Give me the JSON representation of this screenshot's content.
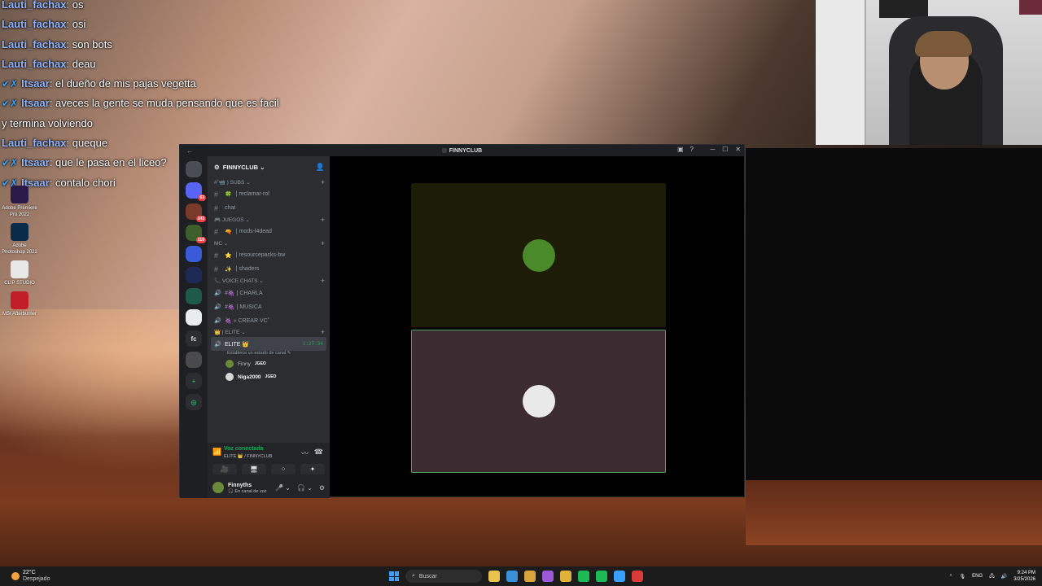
{
  "chat": [
    {
      "user": "Lauti_fachax",
      "text": ": os",
      "badges": false
    },
    {
      "user": "Lauti_fachax",
      "text": ": osi",
      "badges": false
    },
    {
      "user": "Lauti_fachax",
      "text": ": son bots",
      "badges": false
    },
    {
      "user": "Lauti_fachax",
      "text": ": deau",
      "badges": false
    },
    {
      "user": "Itsaar",
      "text": ": el dueño de mis pajas vegetta",
      "badges": true
    },
    {
      "user": "Itsaar",
      "text": ": aveces la gente se muda pensando que es facil",
      "badges": true
    },
    {
      "user": "",
      "text": "y termina volviendo",
      "badges": false
    },
    {
      "user": "Lauti_fachax",
      "text": ": queque",
      "badges": false
    },
    {
      "user": "Itsaar",
      "text": ": que le pasa en el liceo?",
      "badges": true
    },
    {
      "user": "Itsaar",
      "text": ": contalo chori",
      "badges": true
    }
  ],
  "desktop_icons": [
    {
      "label": "Adobe Premiere Pro 2022",
      "color": "#2a1a4a"
    },
    {
      "label": "Adobe Photoshop 2022",
      "color": "#0b2b4a"
    },
    {
      "label": "CLIP STUDIO",
      "color": "#e8e8e8"
    },
    {
      "label": "MSI Afterburner",
      "color": "#c21e2a"
    }
  ],
  "window": {
    "title": "FINNYCLUB",
    "back_glyph": "←",
    "controls": [
      "─",
      "☐",
      "✕"
    ],
    "toolbar_icons": [
      "▣",
      "?"
    ]
  },
  "guilds": [
    {
      "color": "#4b4d55",
      "badge": ""
    },
    {
      "color": "#5865f2",
      "badge": "63"
    },
    {
      "color": "#7a3a2a",
      "badge": "243"
    },
    {
      "color": "#3b5e2b",
      "badge": "319"
    },
    {
      "color": "#3a5bd9",
      "badge": ""
    },
    {
      "color": "#1c2a55",
      "badge": ""
    },
    {
      "color": "#1e5a4a",
      "badge": ""
    },
    {
      "color": "#e9ecef",
      "badge": ""
    },
    {
      "color": "#2b2d31",
      "badge": "",
      "text": "fc"
    },
    {
      "color": "#4a4a4a",
      "badge": ""
    }
  ],
  "server": {
    "name": "FINNYCLUB ⌄",
    "invite_icon": "person-add",
    "categories": [
      {
        "name": "#˚📹 ) SUBS ⌄",
        "channels": [
          {
            "emoji": "🍀",
            "name": "| reclamar-rol"
          },
          {
            "emoji": "",
            "name": "chat"
          }
        ]
      },
      {
        "name": "🎮 JUEGOS ⌄",
        "channels": [
          {
            "emoji": "🔫",
            "name": "| mods-l4dead"
          }
        ]
      },
      {
        "name": "MC ⌄",
        "channels": [
          {
            "emoji": "⭐",
            "name": "| resourcepacks-bw"
          },
          {
            "emoji": "✨",
            "name": "| shaders"
          }
        ]
      },
      {
        "name": "📞 VOICE CHATS ⌄",
        "voice": [
          {
            "name": "#🍇 | CHARLA"
          },
          {
            "name": "#🍇 | MUSICA"
          },
          {
            "name": "🍇 » CREAR VC˚"
          }
        ]
      }
    ],
    "elite": {
      "category": "👑 | ELITE ⌄",
      "channel": "ELITE 👑",
      "timer": "1:27:34",
      "sub": "Establece un estado de canal ✎",
      "members": [
        {
          "name": "Finny",
          "tag": "JGEO",
          "color": "#6a8a3a",
          "bold": false
        },
        {
          "name": "Niga2000",
          "tag": "JGEO",
          "color": "#d8d8d8",
          "bold": true
        }
      ]
    }
  },
  "voice_panel": {
    "status": "Voz conectada",
    "channel": "ELITE 👑 / FINNYCLUB",
    "buttons": [
      "🎥",
      "🖥",
      "⁘",
      "✦"
    ]
  },
  "user_panel": {
    "name": "Finnyths",
    "status": "🎧 En canal de voz",
    "controls": [
      "🎤 ⌄",
      "🎧 ⌄",
      "⚙"
    ]
  },
  "stage": {
    "tiles": [
      {
        "bg": "#1d1c07",
        "border": "#1d1c07",
        "avatar": "#4a8a2a"
      },
      {
        "bg": "#3d2b32",
        "border": "#4aa35a",
        "avatar": "#e9e9e9"
      }
    ]
  },
  "taskbar": {
    "temperature": "22°C",
    "condition": "Despejado",
    "search_placeholder": "Buscar",
    "apps": [
      "#e8c54a",
      "#3a8fd9",
      "#d9a43a",
      "#9b59d9",
      "#e0b13a",
      "#1db954",
      "#1db954",
      "#3aa0ff",
      "#d93a3a"
    ],
    "lang": "ENG",
    "time": "9:24 PM",
    "date": "3/25/2026"
  }
}
